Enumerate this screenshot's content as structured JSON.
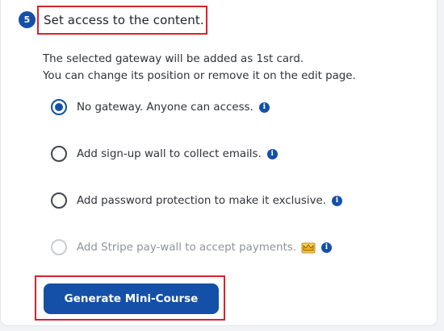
{
  "step": {
    "number": "5",
    "title": "Set access to the content."
  },
  "description": {
    "line1": "The selected gateway will be added as 1st card.",
    "line2": "You can change its position or remove it on the edit page."
  },
  "options": [
    {
      "label": "No gateway. Anyone can access.",
      "selected": true,
      "disabled": false
    },
    {
      "label": "Add sign-up wall to collect emails.",
      "selected": false,
      "disabled": false
    },
    {
      "label": "Add password protection to make it exclusive.",
      "selected": false,
      "disabled": false
    },
    {
      "label": "Add Stripe pay-wall to accept payments.",
      "selected": false,
      "disabled": true,
      "badge_icon": "crown-icon"
    }
  ],
  "info_icon_glyph": "i",
  "button": {
    "label": "Generate Mini-Course"
  },
  "colors": {
    "accent": "#1450a8",
    "highlight_border": "#d8232a",
    "crown": "#f2b31d"
  }
}
